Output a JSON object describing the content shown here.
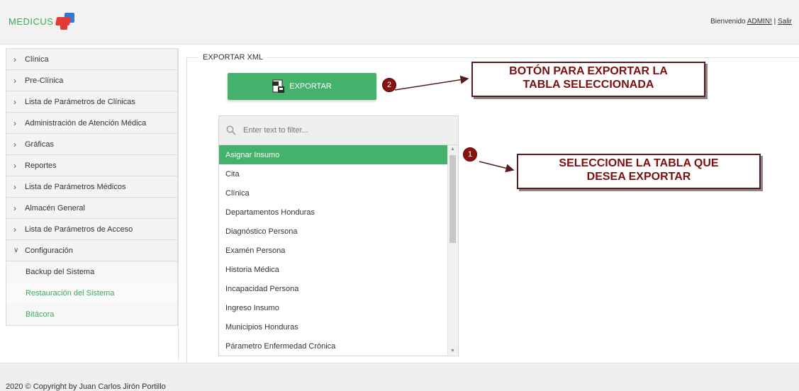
{
  "header": {
    "logo_text": "MEDICUS",
    "welcome_text": "Bienvenido",
    "user": "ADMIN!",
    "separator": "|",
    "logout": "Salir"
  },
  "sidebar": {
    "items": [
      {
        "label": "Clínica"
      },
      {
        "label": "Pre-Clínica"
      },
      {
        "label": "Lista de Parámetros de Clínicas"
      },
      {
        "label": "Administración de Atención Médica"
      },
      {
        "label": "Gráficas"
      },
      {
        "label": "Reportes"
      },
      {
        "label": "Lista de Parámetros Médicos"
      },
      {
        "label": "Almacén General"
      },
      {
        "label": "Lista de Parámetros de Acceso"
      },
      {
        "label": "Configuración"
      }
    ],
    "sub_items": [
      {
        "label": "Backup del Sistema"
      },
      {
        "label": "Restauración del Sistema"
      },
      {
        "label": "Bitácora"
      }
    ]
  },
  "main": {
    "legend": "EXPORTAR XML",
    "export_button": "EXPORTAR",
    "filter_placeholder": "Enter text to filter...",
    "list": [
      "Asignar Insumo",
      "Cita",
      "Clínica",
      "Departamentos Honduras",
      "Diagnóstico Persona",
      "Examén Persona",
      "Historia Médica",
      "Incapacidad Persona",
      "Ingreso Insumo",
      "Municipios Honduras",
      "Párametro Enfermedad Crónica"
    ],
    "selected_index": 0
  },
  "annotations": {
    "badge1": "1",
    "badge2": "2",
    "callout_export_line1": "BOTÓN PARA EXPORTAR LA",
    "callout_export_line2": "TABLA SELECCIONADA",
    "callout_select_line1": "SELECCIONE LA TABLA QUE",
    "callout_select_line2": "DESEA EXPORTAR"
  },
  "footer": {
    "copyright": "2020 © Copyright by Juan Carlos Jirón Portillo"
  },
  "colors": {
    "accent_green": "#45b26b",
    "annotation_red": "#8b1010"
  }
}
